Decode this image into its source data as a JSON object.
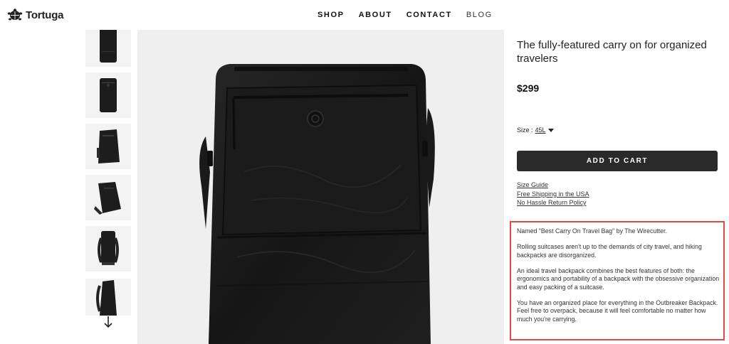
{
  "header": {
    "brand": "Tortuga",
    "nav": [
      {
        "label": "SHOP"
      },
      {
        "label": "ABOUT"
      },
      {
        "label": "CONTACT"
      },
      {
        "label": "BLOG"
      }
    ]
  },
  "gallery": {
    "thumbnail_count": 6,
    "next_icon": "arrow-down-icon"
  },
  "product": {
    "subtitle": "The fully-featured carry on for organized travelers",
    "price": "$299",
    "size_label": "Size :",
    "size_value": "45L",
    "add_to_cart": "ADD TO CART",
    "links": [
      "Size Guide",
      "Free Shipping in the USA",
      "No Hassle Return Policy"
    ],
    "description": [
      "Named \"Best Carry On Travel Bag\" by The Wirecutter.",
      "Rolling suitcases aren't up to the demands of city travel, and hiking backpacks are disorganized.",
      "An ideal travel backpack combines the best features of both: the ergonomics and portability of a backpack with the obsessive organization and easy packing of a suitcase.",
      "You have an organized place for everything in the Outbreaker Backpack. Feel free to overpack, because it will feel comfortable no matter how much you're carrying."
    ]
  },
  "colors": {
    "button_bg": "#2a2a2a",
    "highlight_border": "#e04b43",
    "image_bg": "#efefef"
  }
}
